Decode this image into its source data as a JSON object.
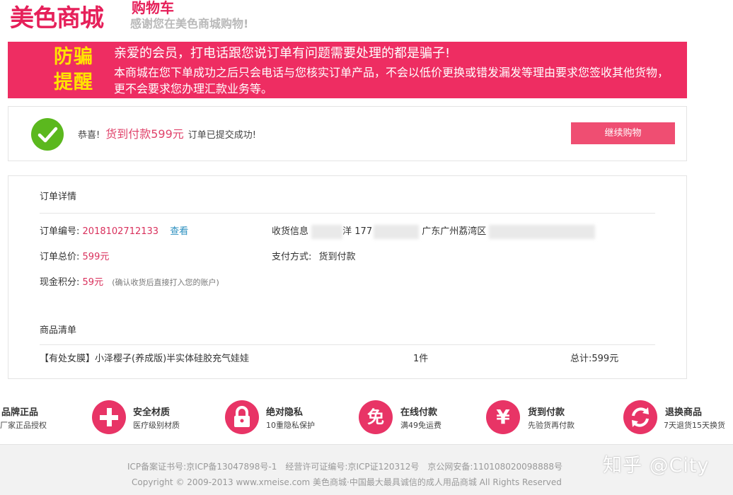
{
  "header": {
    "logo": "美色商城",
    "cart_title": "购物车",
    "cart_subtitle": "感谢您在美色商城购物!"
  },
  "banner": {
    "title": "防骗提醒",
    "line1": "亲爱的会员，打电话跟您说订单有问题需要处理的都是骗子!",
    "line2": "本商城在您下单成功之后只会电话与您核实订单产品，不会以低价更换或错发漏发等理由要求您签收其他货物，更不会要求您办理汇款业务等。",
    "background_color": "#ee2d62",
    "title_color": "#ffe300"
  },
  "success": {
    "prefix": "恭喜!",
    "amount": "货到付款599元",
    "suffix": "订单已提交成功!",
    "continue_button": "继续购物",
    "check_icon": "checkmark-icon"
  },
  "order": {
    "section_title": "订单详情",
    "number_label": "订单编号:",
    "number_value": "2018102712133",
    "view_link": "查看",
    "receiver_label": "收货信息",
    "receiver_name": "洋 177",
    "receiver_address": "广东广州荔湾区",
    "total_label": "订单总价:",
    "total_value": "599元",
    "payment_label": "支付方式:",
    "payment_value": "货到付款",
    "points_label": "现金积分:",
    "points_value": "59元",
    "points_note": "(确认收货后直接打入您的账户)"
  },
  "items": {
    "section_title": "商品清单",
    "rows": [
      {
        "name": "【有处女膜】小泽樱子(养成版)半实体硅胶充气娃娃",
        "qty": "1件",
        "total": "总计:599元"
      }
    ]
  },
  "features": [
    {
      "icon": "certificate-icon",
      "glyph": "",
      "title": "品牌正品",
      "desc": "厂家正品授权"
    },
    {
      "icon": "plus-icon",
      "glyph": "+",
      "title": "安全材质",
      "desc": "医疗级别材质"
    },
    {
      "icon": "lock-icon",
      "glyph": "",
      "title": "绝对隐私",
      "desc": "10重隐私保护"
    },
    {
      "icon": "free-icon",
      "glyph": "免",
      "title": "在线付款",
      "desc": "满49免运费"
    },
    {
      "icon": "yen-icon",
      "glyph": "¥",
      "title": "货到付款",
      "desc": "先验货再付款"
    },
    {
      "icon": "refresh-icon",
      "glyph": "",
      "title": "退换商品",
      "desc": "7天退货15天换货"
    }
  ],
  "footer": {
    "line1": "ICP备案证书号:京ICP备13047898号-1　经营许可证编号:京ICP证120312号　京公网安备:110108020098888号",
    "line2": "Copyright © 2009-2013 www.xmeise.com 美色商城·中国最大最具诚信的成人用品商城 All Rights Reserved",
    "watermark": "知乎 @City"
  },
  "colors": {
    "accent": "#e6205a",
    "button": "#ef4e72",
    "success_green": "#5bb81e",
    "link": "#2b8fbf"
  }
}
